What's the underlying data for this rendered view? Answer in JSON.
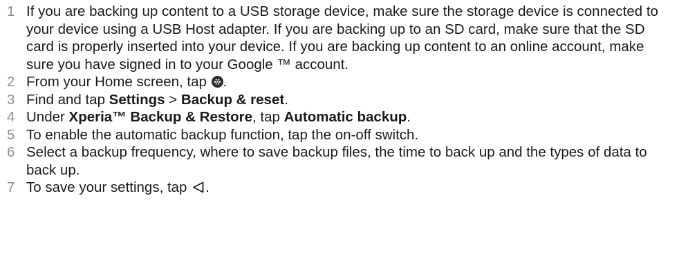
{
  "steps": [
    {
      "num": "1",
      "text": "If you are backing up content to a USB storage device, make sure the storage device is connected to your device using a USB Host adapter. If you are backing up to an SD card, make sure that the SD card is properly inserted into your device. If you are backing up content to an online account, make sure you have signed in to your Google ™ account."
    },
    {
      "num": "2",
      "pre": "From your Home screen, tap ",
      "post": ".",
      "icon": "apps-icon"
    },
    {
      "num": "3",
      "pre": "Find and tap ",
      "b1": "Settings",
      "mid": " > ",
      "b2": "Backup & reset",
      "post": "."
    },
    {
      "num": "4",
      "pre": "Under ",
      "b1": "Xperia™ Backup & Restore",
      "mid": ", tap ",
      "b2": "Automatic backup",
      "post": "."
    },
    {
      "num": "5",
      "text": "To enable the automatic backup function, tap the on-off switch."
    },
    {
      "num": "6",
      "text": "Select a backup frequency, where to save backup files, the time to back up and the types of data to back up."
    },
    {
      "num": "7",
      "pre": "To save your settings, tap ",
      "post": ".",
      "icon": "back-icon"
    }
  ]
}
